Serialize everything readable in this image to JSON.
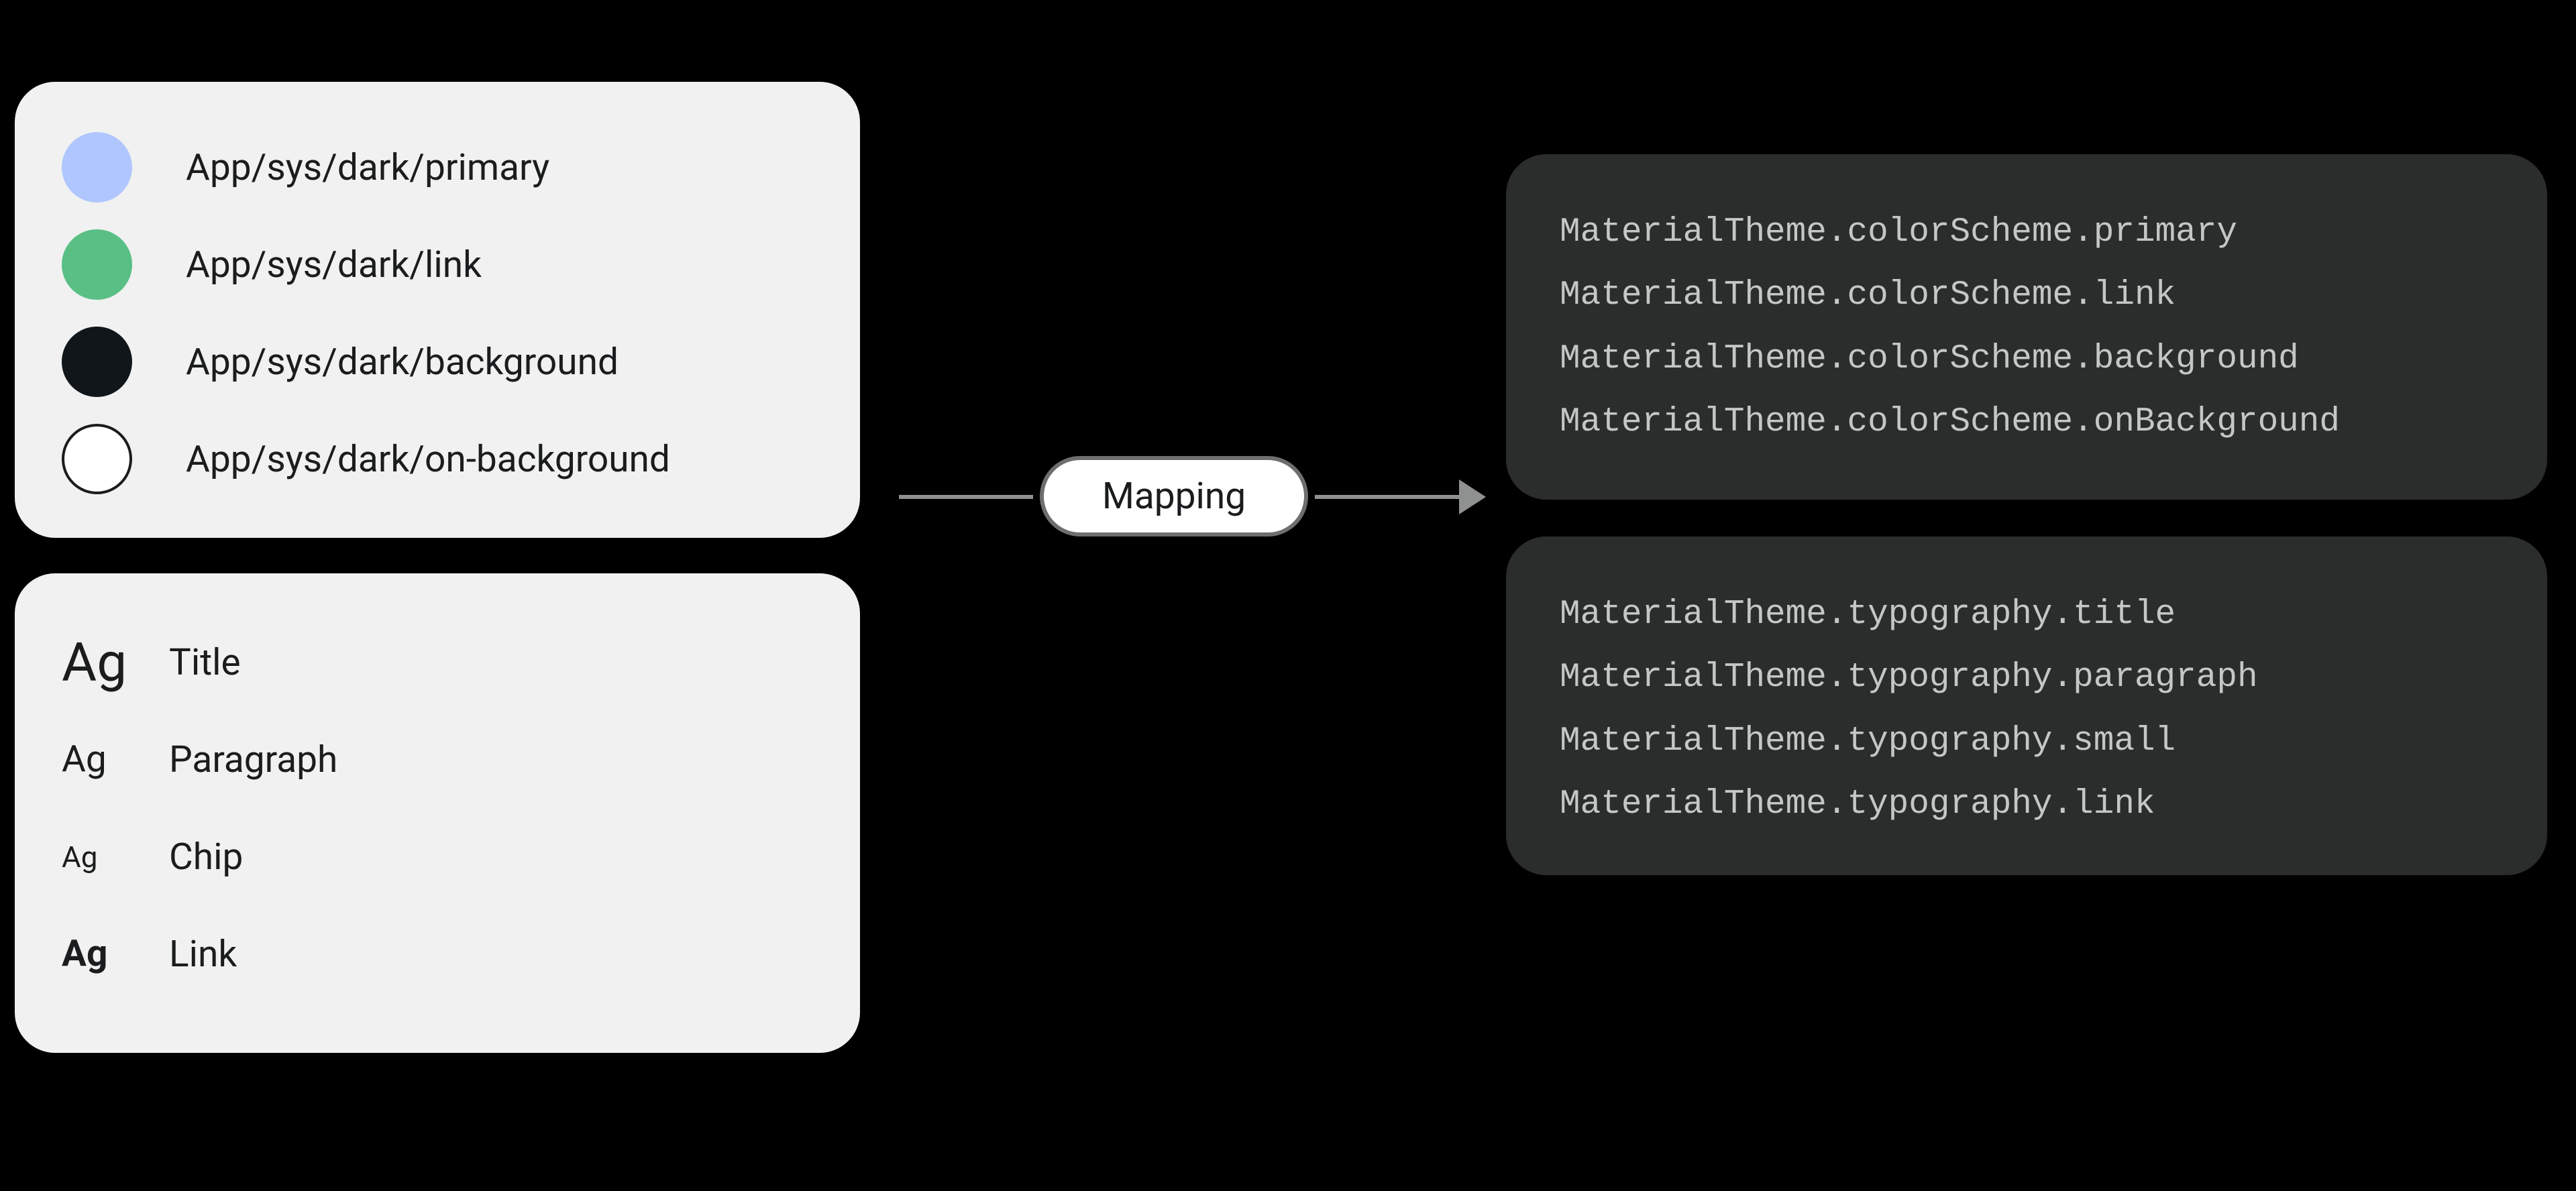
{
  "mapping_label": "Mapping",
  "colors": {
    "swatch_primary": "#b0c6ff",
    "swatch_link": "#59bf85",
    "swatch_background": "#11161a",
    "swatch_onbackground": "#ffffff",
    "items": [
      {
        "label": "App/sys/dark/primary"
      },
      {
        "label": "App/sys/dark/link"
      },
      {
        "label": "App/sys/dark/background"
      },
      {
        "label": "App/sys/dark/on-background"
      }
    ]
  },
  "typography": {
    "sample_glyph": "Ag",
    "items": [
      {
        "name": "Title"
      },
      {
        "name": "Paragraph"
      },
      {
        "name": "Chip"
      },
      {
        "name": "Link"
      }
    ]
  },
  "code_colors": [
    "MaterialTheme.colorScheme.primary",
    "MaterialTheme.colorScheme.link",
    "MaterialTheme.colorScheme.background",
    "MaterialTheme.colorScheme.onBackground"
  ],
  "code_typography": [
    "MaterialTheme.typography.title",
    "MaterialTheme.typography.paragraph",
    "MaterialTheme.typography.small",
    "MaterialTheme.typography.link"
  ]
}
